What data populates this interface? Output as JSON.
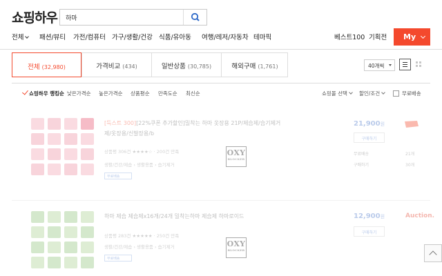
{
  "header": {
    "logo": "쇼핑하우",
    "search": {
      "value": "하마",
      "placeholder": ""
    },
    "nav": [
      "전체",
      "패션/뷰티",
      "가전/컴퓨터",
      "가구/생활/건강",
      "식품/유아동",
      "여행/레저/자동차",
      "테마픽"
    ],
    "nav_right": [
      "베스트100",
      "기획전"
    ],
    "my_label": "My",
    "brand_color": "#f4492d"
  },
  "tabs": [
    {
      "label": "전체",
      "count": "(32,980)",
      "active": true
    },
    {
      "label": "가격비교",
      "count": "(434)",
      "active": false
    },
    {
      "label": "일반상품",
      "count": "(30,785)",
      "active": false
    },
    {
      "label": "해외구매",
      "count": "(1,761)",
      "active": false
    }
  ],
  "view": {
    "per_page": "40개씩"
  },
  "sorts": [
    "쇼핑하우 랭킹순",
    "낮은가격순",
    "높은가격순",
    "상품평순",
    "만족도순",
    "최신순"
  ],
  "filters": {
    "mall": "쇼핑몰 선택",
    "discount": "할인/조건",
    "free_shipping": "무료배송"
  },
  "products": [
    {
      "title_tag": "[득스트 300]",
      "title": "[22%쿠폰 추가할인]밀착는 하마 옷장용 21P/제습제/습기제거제/옷장용/신발장용/b",
      "meta1": "상품평 306건 ★★★★☆ · 200건 만족",
      "meta2": "생활/건강/제습 › 생활용품 › 습기제거",
      "small_tag": "무료배송",
      "oxy_big": "OXY",
      "oxy_small": "BLOCKER",
      "price": "21,900",
      "price_unit": "원",
      "compare": "구매하기",
      "side1": "무료배송",
      "side2": "21개",
      "side3": "구매하기",
      "side4": "30개",
      "mall": ""
    },
    {
      "title_tag": "",
      "title": "하마 제습 제습제x16개/24개 밀착는하마 제습제 하마로이드",
      "meta1": "상품평 283건 ★★★★★ · 250건 만족",
      "meta2": "생활/건강/제습 › 생활용품 › 습기제거",
      "small_tag": "무료배송",
      "oxy_big": "OXY",
      "oxy_small": "BLOCKER",
      "price": "12,900",
      "price_unit": "원",
      "compare": "구매하기",
      "mall": "Auction."
    }
  ]
}
